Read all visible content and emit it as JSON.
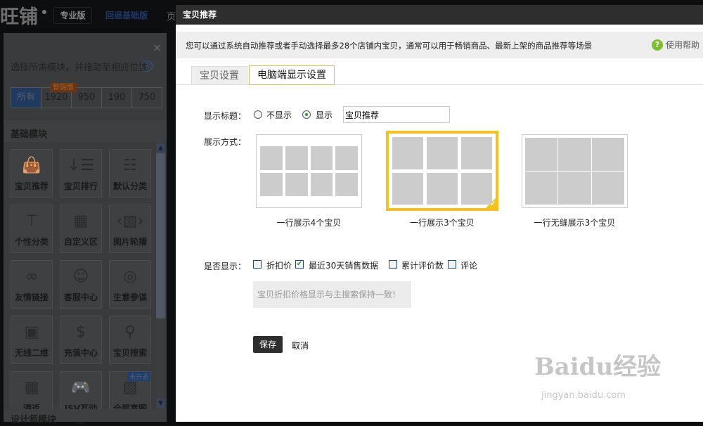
{
  "background": {
    "logo": "旺铺",
    "edition": "专业版",
    "revert_link": "回退基础版",
    "page_link": "页",
    "panel": {
      "close": "×",
      "instruction": "选择所需模块，并拖动至相应位置",
      "help": "?",
      "size_tabs": [
        "所有",
        "1920",
        "950",
        "190",
        "750"
      ],
      "smart_badge": "智能版",
      "section_basic": "基础模块",
      "tiles": [
        {
          "label": "宝贝推荐",
          "icon": "bag-icon",
          "glyph": "👜"
        },
        {
          "label": "宝贝排行",
          "icon": "sort-list-icon",
          "glyph": "↓☰"
        },
        {
          "label": "默认分类",
          "icon": "category-icon",
          "glyph": "☷"
        },
        {
          "label": "个性分类",
          "icon": "tree-icon",
          "glyph": "⊤"
        },
        {
          "label": "自定义区",
          "icon": "grid-icon",
          "glyph": "▦"
        },
        {
          "label": "图片轮播",
          "icon": "carousel-icon",
          "glyph": "‹▨›"
        },
        {
          "label": "友情链接",
          "icon": "link-icon",
          "glyph": "∞"
        },
        {
          "label": "客服中心",
          "icon": "service-icon",
          "glyph": "☺"
        },
        {
          "label": "生意参谋",
          "icon": "compass-icon",
          "glyph": "◎"
        },
        {
          "label": "无线二维",
          "icon": "qrcode-icon",
          "glyph": "▣"
        },
        {
          "label": "充值中心",
          "icon": "dollar-icon",
          "glyph": "$"
        },
        {
          "label": "宝贝搜索",
          "icon": "search-icon",
          "glyph": "⚲"
        },
        {
          "label": "满返",
          "icon": "grid-icon",
          "glyph": "▦"
        },
        {
          "label": "ISV互动游",
          "icon": "gamepad-icon",
          "glyph": "🎮"
        },
        {
          "label": "全屏宽图",
          "icon": "image-icon",
          "glyph": "▨",
          "tag": "未开通"
        }
      ],
      "section_designer": "设计师模块"
    }
  },
  "modal": {
    "title": "宝贝推荐",
    "info": "您可以通过系统自动推荐或者手动选择最多28个店铺内宝贝，通常可以用于畅销商品、最新上架的商品推荐等场景",
    "help": "使用帮助",
    "tabs": [
      "宝贝设置",
      "电脑端显示设置"
    ],
    "active_tab": 1,
    "show_title_label": "显示标题：",
    "radio_hide": "不显示",
    "radio_show": "显示",
    "title_value": "宝贝推荐",
    "display_label": "展示方式：",
    "options": [
      {
        "caption": "一行展示4个宝贝",
        "selected": false
      },
      {
        "caption": "一行展示3个宝贝",
        "selected": true
      },
      {
        "caption": "一行无缝展示3个宝贝",
        "selected": false
      }
    ],
    "show_label": "是否显示：",
    "checks": [
      {
        "label": "折扣价",
        "checked": false
      },
      {
        "label": "最近30天销售数据",
        "checked": true
      },
      {
        "label": "累计评价数",
        "checked": false
      },
      {
        "label": "评论",
        "checked": false
      }
    ],
    "note": "宝贝折扣价格显示与主搜索保持一致!",
    "save": "保存",
    "cancel": "取消"
  },
  "watermark": {
    "logo": "Baidu经验",
    "url_text": "jingyan.baidu.com"
  }
}
